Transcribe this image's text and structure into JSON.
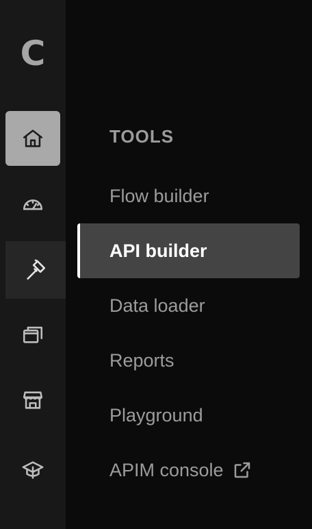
{
  "logo": {
    "text": "C"
  },
  "rail": {
    "items": [
      {
        "icon": "home-icon",
        "active": true
      },
      {
        "icon": "speedometer-icon",
        "active": false
      },
      {
        "icon": "hammer-icon",
        "active": true
      },
      {
        "icon": "windows-icon",
        "active": false
      },
      {
        "icon": "store-icon",
        "active": false
      },
      {
        "icon": "graduation-cap-icon",
        "active": false
      }
    ]
  },
  "menu": {
    "section_title": "TOOLS",
    "items": [
      {
        "label": "Flow builder"
      },
      {
        "label": "API builder",
        "active": true
      },
      {
        "label": "Data loader"
      },
      {
        "label": "Reports"
      },
      {
        "label": "Playground"
      },
      {
        "label": "APIM console",
        "icon": "external-link-icon"
      }
    ]
  },
  "colors": {
    "rail_bg": "#181818",
    "panel_bg": "#0b0b0b",
    "active_item_bg": "#444444",
    "home_button_bg": "#a9a9a9",
    "text_muted": "#9c9c9c",
    "text_active": "#ffffff"
  }
}
